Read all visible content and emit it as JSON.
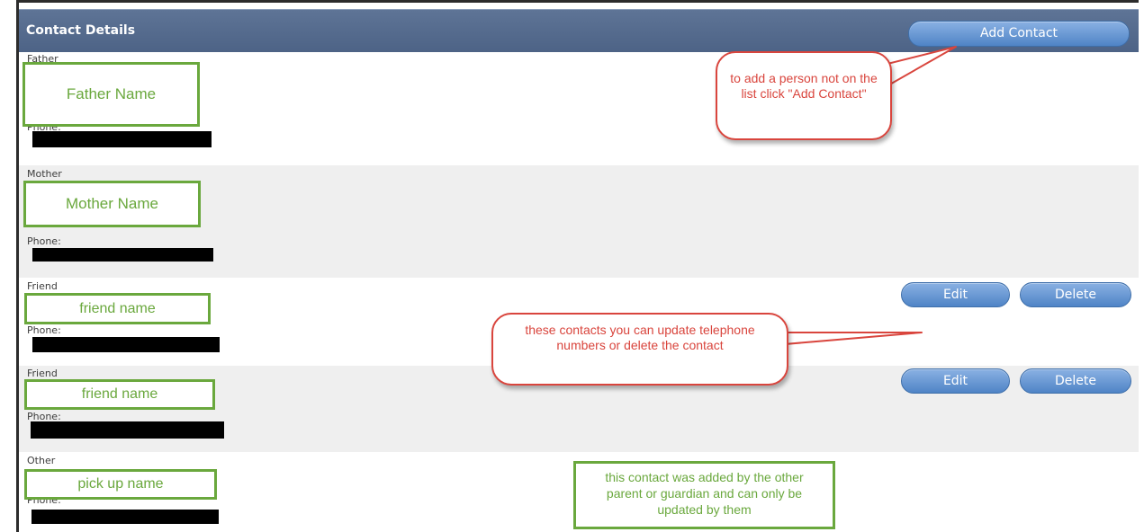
{
  "header": {
    "title": "Contact Details",
    "add_contact_label": "Add Contact"
  },
  "contacts": [
    {
      "relationship": "Father",
      "name": "Father Name",
      "phone_label": "Phone:"
    },
    {
      "relationship": "Mother",
      "name": "Mother Name",
      "phone_label": "Phone:"
    },
    {
      "relationship": "Friend",
      "name": "friend name",
      "phone_label": "Phone:",
      "edit_label": "Edit",
      "delete_label": "Delete"
    },
    {
      "relationship": "Friend",
      "name": "friend name",
      "phone_label": "Phone:",
      "edit_label": "Edit",
      "delete_label": "Delete"
    },
    {
      "relationship": "Other",
      "name": "pick up name",
      "phone_label": "Phone:"
    }
  ],
  "annotations": {
    "add_contact_note": "to add a person not on the list click \"Add Contact\"",
    "update_note": "these contacts you can update telephone numbers or delete the contact",
    "other_parent_note": "this contact was added by the other parent or guardian and can only be updated by them"
  },
  "colors": {
    "header": "#546a8d",
    "button": "#5b8dcc",
    "callout_red": "#d9453d",
    "callout_green": "#6aa83d",
    "row_alt": "#efefef"
  }
}
